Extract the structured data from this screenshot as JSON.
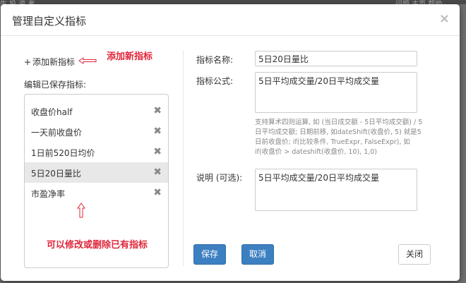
{
  "modal": {
    "title": "管理自定义指标",
    "close_glyph": "×"
  },
  "left": {
    "add_label": "添加新指标",
    "add_annotation": "添加新指标",
    "saved_heading": "编辑已保存指标:",
    "saved_items": [
      {
        "label": "收盘价half"
      },
      {
        "label": "一天前收盘价"
      },
      {
        "label": "1日前520日均价"
      },
      {
        "label": "5日20日量比",
        "active": true
      },
      {
        "label": "市盈净率"
      }
    ],
    "edit_annotation": "可以修改或删除已有指标",
    "delete_glyph": "✖"
  },
  "form": {
    "name_label": "指标名称:",
    "name_value": "5日20日量比",
    "formula_label": "指标公式:",
    "formula_value": "5日平均成交量/20日平均成交量",
    "help_text": "支持算术四则运算, 如 (当日成交额 - 5日平均成交额) / 5日平均成交额; 日期前移, 如dateShift(收盘价, 5) 就是5日前收盘价; if(比较条件, TrueExpr, FalseExpr), 如 if(收盘价 > dateshift(收盘价, 10), 1,0)",
    "desc_label": "说明 (可选):",
    "desc_value": "5日平均成交量/20日平均成交量"
  },
  "buttons": {
    "save": "保存",
    "cancel": "取消",
    "close": "关闭"
  },
  "background": {
    "left_text": "生 投 资 者",
    "right_text": "问题 主页    帮助"
  },
  "colors": {
    "primary": "#3d80c1",
    "annotation": "#e0263a"
  }
}
